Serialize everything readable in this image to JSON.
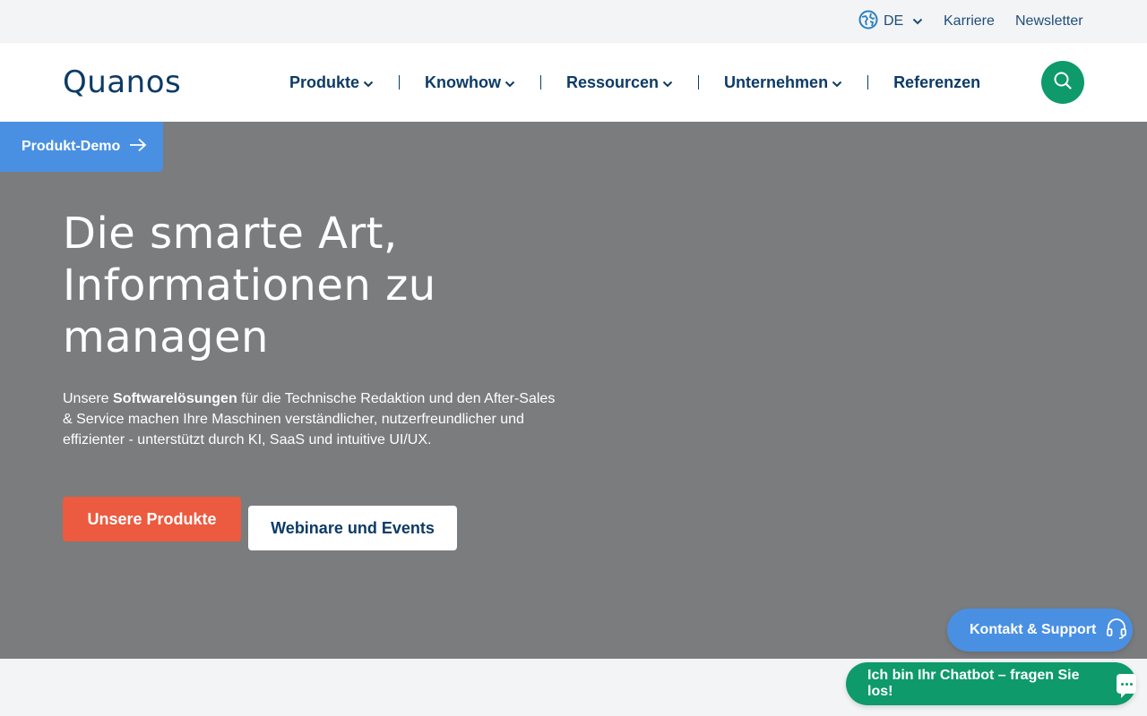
{
  "topbar": {
    "language": "DE",
    "links": [
      "Karriere",
      "Newsletter"
    ]
  },
  "header": {
    "logo_text": "Quanos",
    "nav": [
      {
        "label": "Produkte",
        "has_dropdown": true
      },
      {
        "label": "Knowhow",
        "has_dropdown": true
      },
      {
        "label": "Ressourcen",
        "has_dropdown": true
      },
      {
        "label": "Unternehmen",
        "has_dropdown": true
      },
      {
        "label": "Referenzen",
        "has_dropdown": false
      }
    ],
    "search_icon": "search-icon"
  },
  "hero": {
    "demo_tab": "Produkt-Demo",
    "headline_lines": [
      "Die smarte Art,",
      "Informationen zu",
      "managen"
    ],
    "lead_before": "Unsere ",
    "lead_bold": "Softwarelösungen",
    "lead_after": " für die Technische Redaktion und den After-Sales & Service machen Ihre Maschinen verständlicher, nutzerfreundlicher und effizienter - unterstützt durch KI, SaaS und intuitive UI/UX.",
    "primary_button": "Unsere Produkte",
    "secondary_button": "Webinare und Events"
  },
  "floating": {
    "contact_label": "Kontakt & Support",
    "chatbot_label": "Ich bin Ihr Chatbot – fragen Sie los!"
  },
  "colors": {
    "brand_navy": "#0d3b66",
    "green": "#0e9a6a",
    "blue": "#4a90e2",
    "orange": "#ec5a3f",
    "hero_bg": "#7b7c7e"
  }
}
